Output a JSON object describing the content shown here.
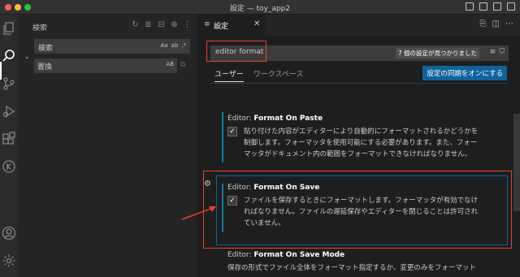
{
  "window": {
    "title": "設定 — toy_app2"
  },
  "activity_bar": {
    "icons": [
      "explorer-icon",
      "search-icon",
      "source-control-icon",
      "run-debug-icon",
      "extensions-icon",
      "remote-icon",
      "account-icon",
      "manage-gear-icon"
    ]
  },
  "sidebar": {
    "title": "検索",
    "actions": [
      "refresh-icon",
      "clear-results-icon",
      "collapse-all-icon",
      "new-search-editor-icon",
      "view-as-tree-icon"
    ],
    "search": {
      "placeholder": "検索",
      "value": "",
      "options": {
        "match_case": "Aa",
        "whole_word": "ab",
        "regex": ".*"
      }
    },
    "replace": {
      "placeholder": "置換",
      "value": "",
      "options": {
        "preserve_case": "AB"
      }
    }
  },
  "editor": {
    "tab": {
      "label": "設定",
      "icon": "settings-file-icon"
    },
    "actions": [
      "open-json-icon",
      "split-editor-icon",
      "more-actions-icon"
    ],
    "settings_search": {
      "value": "editor format",
      "match_count": "7 個の設定が見つかりました"
    },
    "scope_tabs": [
      {
        "label": "ユーザー",
        "active": true
      },
      {
        "label": "ワークスペース",
        "active": false
      }
    ],
    "sync_button": "設定の同期をオンにする",
    "settings": [
      {
        "prefix": "Editor: ",
        "name": "Format On Paste",
        "checked": true,
        "description": [
          "貼り付けた内容がエディターにより自動的にフォーマットされるかどうかを",
          "制御します。フォーマッタを使用可能にする必要があります。また、フォー",
          "マッタがドキュメント内の範囲をフォーマットできなければなりません。"
        ]
      },
      {
        "prefix": "Editor: ",
        "name": "Format On Save",
        "checked": true,
        "description": [
          "ファイルを保存するときにフォーマットします。フォーマッタが有効でなけ",
          "ればなりません。ファイルの遅延保存やエディターを閉じることは許可され",
          "ていません。"
        ]
      },
      {
        "prefix": "Editor: ",
        "name": "Format On Save Mode",
        "description": [
          "保存の形式でファイル全体をフォーマット指定するか、変更のみをフォーマット"
        ]
      }
    ]
  },
  "colors": {
    "accent": "#0e639c",
    "annotation": "#e8412c",
    "modified": "#0c7d9d"
  }
}
